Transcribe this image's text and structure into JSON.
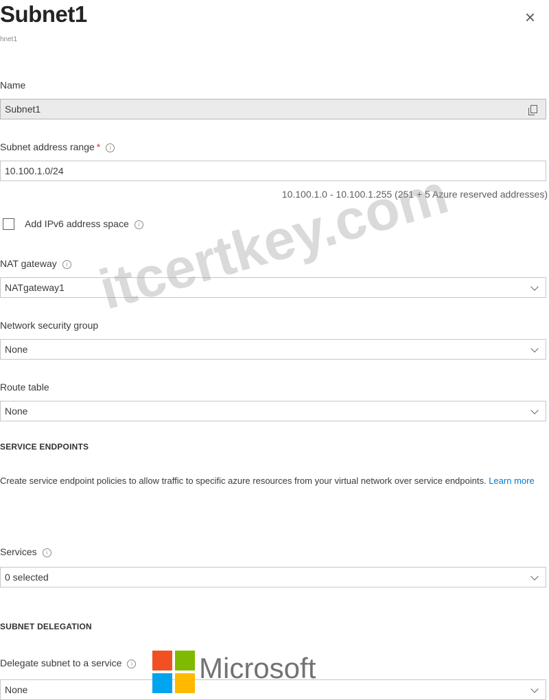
{
  "panel": {
    "title": "Subnet1",
    "subtitle": "hnet1",
    "close_glyph": "×"
  },
  "fields": {
    "name": {
      "label": "Name",
      "value": "Subnet1"
    },
    "address_range": {
      "label": "Subnet address range",
      "required": "*",
      "value": "10.100.1.0/24",
      "hint": "10.100.1.0 - 10.100.1.255 (251 + 5 Azure reserved addresses)"
    },
    "ipv6": {
      "label": "Add IPv6 address space",
      "checked": false
    },
    "nat_gateway": {
      "label": "NAT gateway",
      "value": "NATgateway1"
    },
    "nsg": {
      "label": "Network security group",
      "value": "None"
    },
    "route_table": {
      "label": "Route table",
      "value": "None"
    }
  },
  "service_endpoints": {
    "heading": "SERVICE ENDPOINTS",
    "description": "Create service endpoint policies to allow traffic to specific azure resources from your virtual network over service endpoints.",
    "learn_more": "Learn more",
    "services_label": "Services",
    "services_value": "0 selected"
  },
  "subnet_delegation": {
    "heading": "SUBNET DELEGATION",
    "label": "Delegate subnet to a service",
    "value": "None"
  },
  "watermark": "itcertkey.com",
  "brand": {
    "name": "Microsoft",
    "colors": [
      "#f25022",
      "#7fba00",
      "#00a4ef",
      "#ffb900"
    ]
  },
  "icons": {
    "close": "close-icon",
    "info": "info-icon",
    "copy": "copy-icon",
    "dropdown": "chevron-down-icon"
  }
}
